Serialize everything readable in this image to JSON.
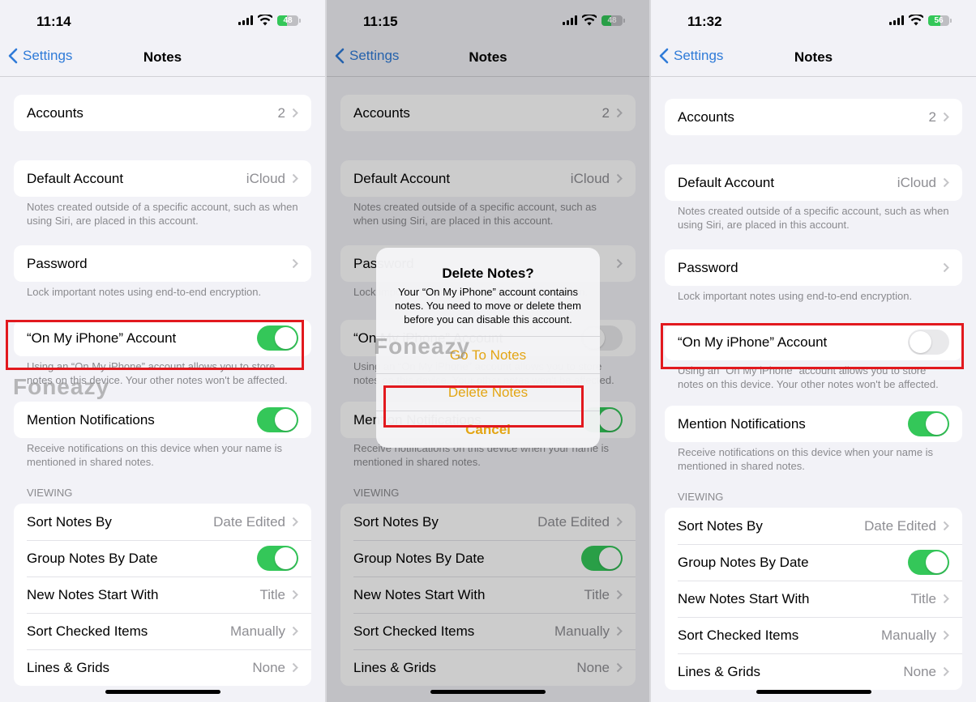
{
  "colors": {
    "accent_blue": "#2f7bd8",
    "toggle_on": "#34c759",
    "toggle_off": "#e9e9eb",
    "alert_button": "#e3a514",
    "highlight_red": "#e2191e"
  },
  "watermark": "Foneazy",
  "screens": [
    {
      "status": {
        "time": "11:14",
        "battery": "48",
        "battery_level": 0.48
      },
      "nav": {
        "back_label": "Settings",
        "title": "Notes"
      },
      "accounts": {
        "label": "Accounts",
        "value": "2"
      },
      "default_account": {
        "label": "Default Account",
        "value": "iCloud",
        "footer": "Notes created outside of a specific account, such as when using Siri, are placed in this account."
      },
      "password": {
        "label": "Password",
        "footer": "Lock important notes using end-to-end encryption."
      },
      "on_my_iphone": {
        "label": "“On My iPhone” Account",
        "toggle": true,
        "footer": "Using an “On My iPhone” account allows you to store notes on this device. Your other notes won't be affected."
      },
      "mention": {
        "label": "Mention Notifications",
        "toggle": true,
        "footer": "Receive notifications on this device when your name is mentioned in shared notes."
      },
      "viewing": {
        "header": "VIEWING",
        "rows": [
          {
            "label": "Sort Notes By",
            "value": "Date Edited"
          },
          {
            "label": "Group Notes By Date",
            "toggle": true
          },
          {
            "label": "New Notes Start With",
            "value": "Title"
          },
          {
            "label": "Sort Checked Items",
            "value": "Manually"
          },
          {
            "label": "Lines & Grids",
            "value": "None"
          }
        ]
      }
    },
    {
      "status": {
        "time": "11:15",
        "battery": "48",
        "battery_level": 0.48
      },
      "nav": {
        "back_label": "Settings",
        "title": "Notes"
      },
      "accounts": {
        "label": "Accounts",
        "value": "2"
      },
      "default_account": {
        "label": "Default Account",
        "value": "iCloud",
        "footer": "Notes created outside of a specific account, such as when using Siri, are placed in this account."
      },
      "password": {
        "label": "Password",
        "footer": "Lock important notes using end-to-end encryption."
      },
      "on_my_iphone": {
        "label": "“On My iPhone” Account",
        "toggle": false,
        "footer": "Using an “On My iPhone” account allows you to store notes on this device. Your other notes won't be affected."
      },
      "mention": {
        "label": "Mention Notifications",
        "toggle": true,
        "footer": "Receive notifications on this device when your name is mentioned in shared notes."
      },
      "viewing": {
        "header": "VIEWING",
        "rows": [
          {
            "label": "Sort Notes By",
            "value": "Date Edited"
          },
          {
            "label": "Group Notes By Date",
            "toggle": true
          },
          {
            "label": "New Notes Start With",
            "value": "Title"
          },
          {
            "label": "Sort Checked Items",
            "value": "Manually"
          },
          {
            "label": "Lines & Grids",
            "value": "None"
          }
        ]
      },
      "alert": {
        "title": "Delete Notes?",
        "message": "Your “On My iPhone” account contains notes. You need to move or delete them before you can disable this account.",
        "buttons": [
          "Go To Notes",
          "Delete Notes",
          "Cancel"
        ]
      }
    },
    {
      "status": {
        "time": "11:32",
        "battery": "56",
        "battery_level": 0.56
      },
      "nav": {
        "back_label": "Settings",
        "title": "Notes"
      },
      "accounts": {
        "label": "Accounts",
        "value": "2"
      },
      "default_account": {
        "label": "Default Account",
        "value": "iCloud",
        "footer": "Notes created outside of a specific account, such as when using Siri, are placed in this account."
      },
      "password": {
        "label": "Password",
        "footer": "Lock important notes using end-to-end encryption."
      },
      "on_my_iphone": {
        "label": "“On My iPhone” Account",
        "toggle": false,
        "footer": "Using an “On My iPhone” account allows you to store notes on this device. Your other notes won't be affected."
      },
      "mention": {
        "label": "Mention Notifications",
        "toggle": true,
        "footer": "Receive notifications on this device when your name is mentioned in shared notes."
      },
      "viewing": {
        "header": "VIEWING",
        "rows": [
          {
            "label": "Sort Notes By",
            "value": "Date Edited"
          },
          {
            "label": "Group Notes By Date",
            "toggle": true
          },
          {
            "label": "New Notes Start With",
            "value": "Title"
          },
          {
            "label": "Sort Checked Items",
            "value": "Manually"
          },
          {
            "label": "Lines & Grids",
            "value": "None"
          }
        ]
      }
    }
  ]
}
